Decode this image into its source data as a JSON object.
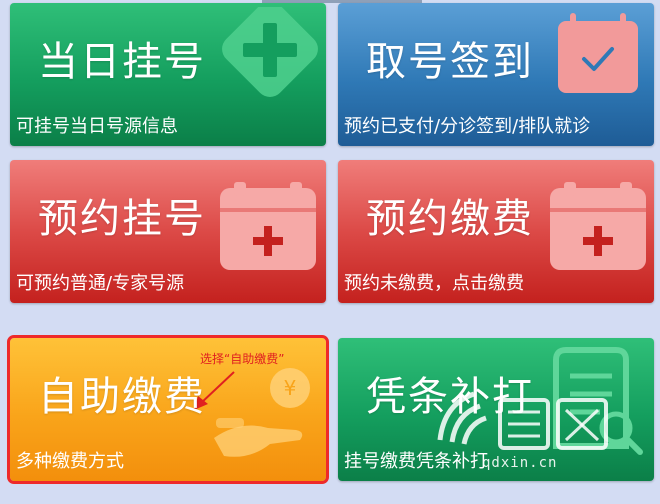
{
  "tiles": [
    {
      "title": "当日挂号",
      "subtitle": "可挂号当日号源信息"
    },
    {
      "title": "取号签到",
      "subtitle": "预约已支付/分诊签到/排队就诊"
    },
    {
      "title": "预约挂号",
      "subtitle": "可预约普通/专家号源"
    },
    {
      "title": "预约缴费",
      "subtitle": "预约未缴费，点击缴费"
    },
    {
      "title": "自助缴费",
      "subtitle": "多种缴费方式"
    },
    {
      "title": "凭条补打",
      "subtitle": "挂号缴费凭条补打"
    }
  ],
  "annotation": {
    "text": "选择“自助缴费”",
    "color": "#e02020"
  },
  "watermark": {
    "text": "qdxin.cn"
  },
  "colors": {
    "green": "#149e5e",
    "blue": "#2f79b6",
    "red": "#dc4a47",
    "orange": "#f9a41a",
    "highlight": "#ee2a2a"
  }
}
